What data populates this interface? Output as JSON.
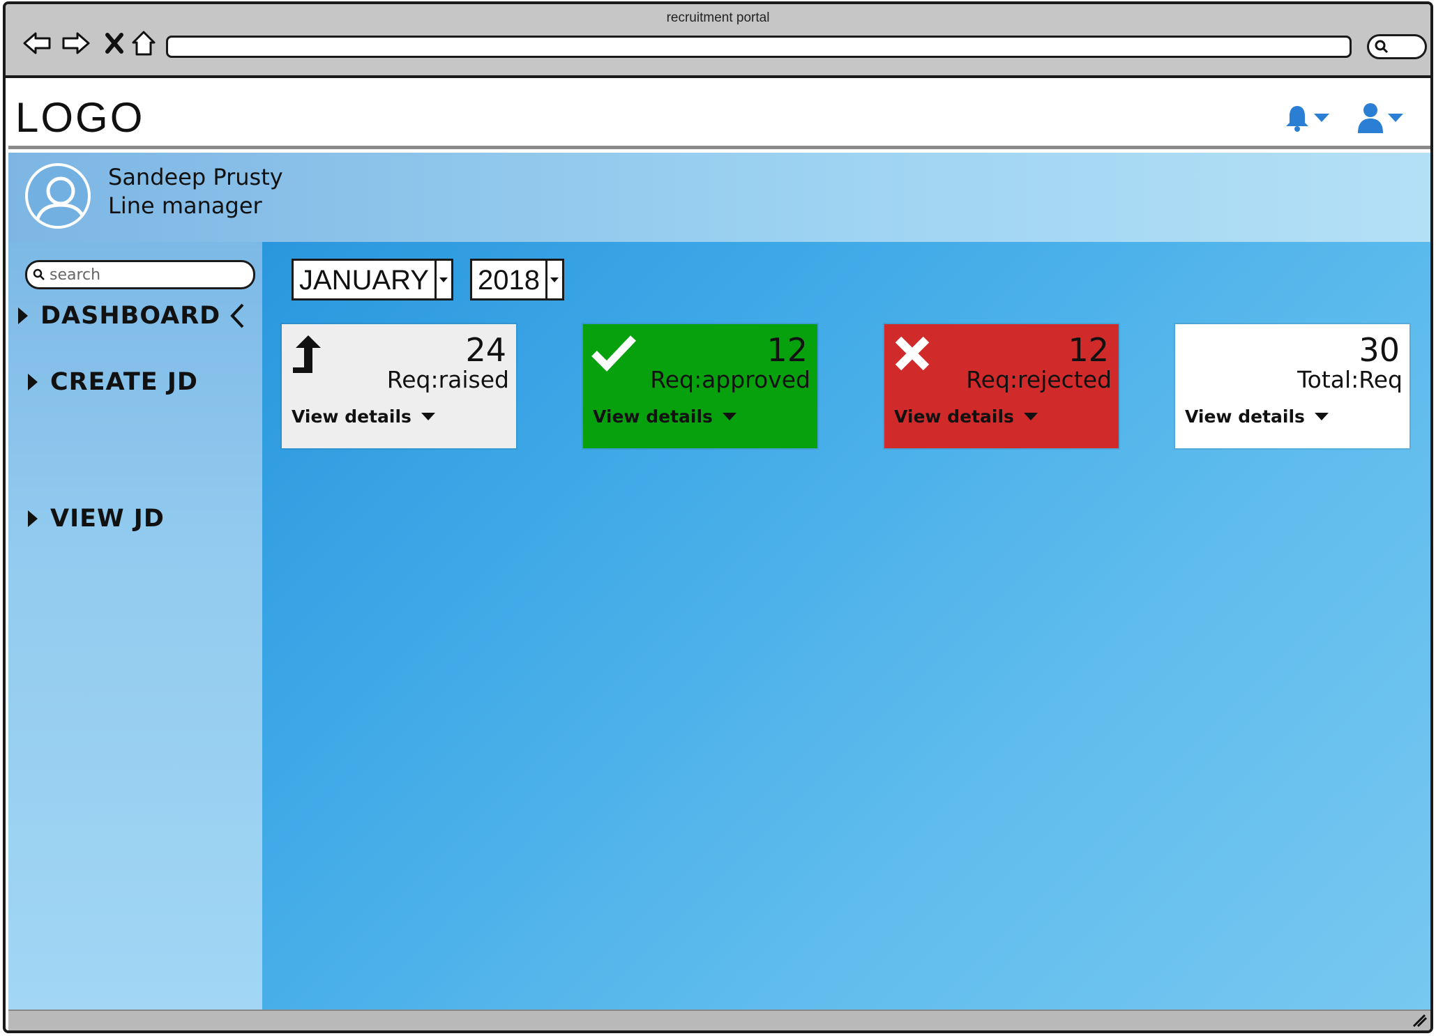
{
  "window": {
    "title": "recruitment portal"
  },
  "header": {
    "logo": "LOGO"
  },
  "user": {
    "name": "Sandeep Prusty",
    "role": "Line manager"
  },
  "sidebar": {
    "search_placeholder": "search",
    "items": [
      {
        "label": "DASHBOARD"
      },
      {
        "label": "CREATE JD"
      },
      {
        "label": "VIEW JD"
      }
    ]
  },
  "filters": {
    "month": "JANUARY",
    "year": "2018"
  },
  "cards": [
    {
      "value": "24",
      "label": "Req:raised",
      "link": "View details",
      "color": "#eeeeee"
    },
    {
      "value": "12",
      "label": "Req:approved",
      "link": "View details",
      "color": "#07a10d"
    },
    {
      "value": "12",
      "label": "Req:rejected",
      "link": "View details",
      "color": "#d12a2a"
    },
    {
      "value": "30",
      "label": "Total:Req",
      "link": "View details",
      "color": "#ffffff"
    }
  ],
  "colors": {
    "accent": "#2a7fd4",
    "background_blue": "#3aa6e6"
  }
}
